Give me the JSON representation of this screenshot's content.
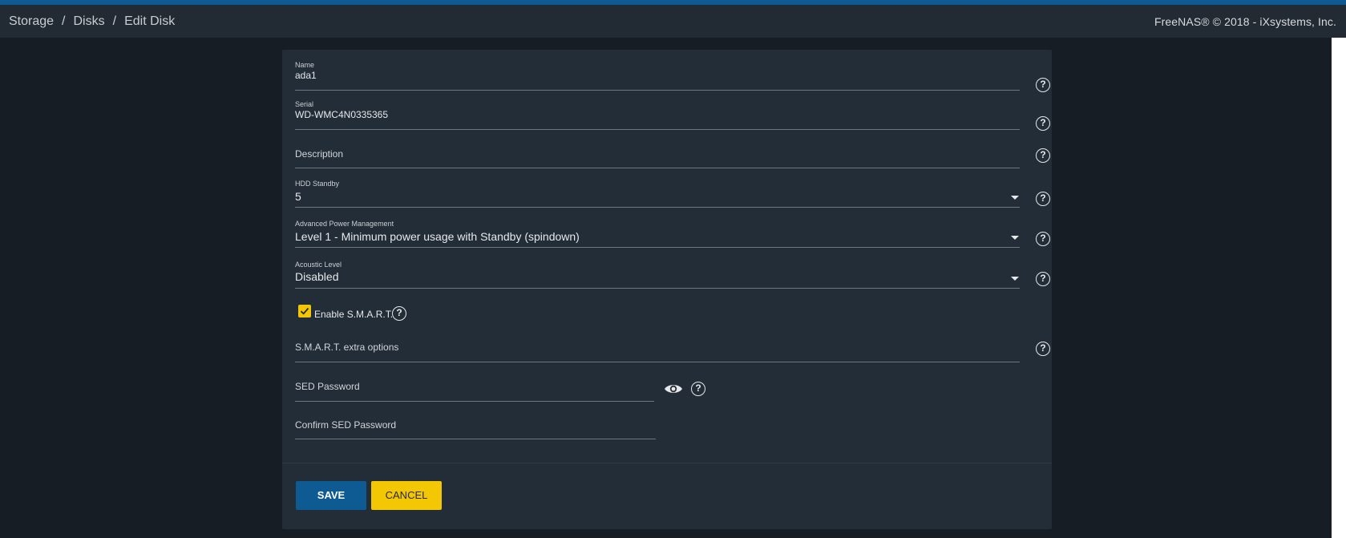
{
  "breadcrumb": {
    "items": [
      "Storage",
      "Disks",
      "Edit Disk"
    ],
    "separator": "/"
  },
  "header": {
    "copyright": "FreeNAS® © 2018 - iXsystems, Inc."
  },
  "form": {
    "name": {
      "label": "Name",
      "value": "ada1"
    },
    "serial": {
      "label": "Serial",
      "value": "WD-WMC4N0335365"
    },
    "description": {
      "placeholder": "Description"
    },
    "hdd_standby": {
      "label": "HDD Standby",
      "value": "5"
    },
    "apm": {
      "label": "Advanced Power Management",
      "value": "Level 1 - Minimum power usage with Standby (spindown)"
    },
    "acoustic": {
      "label": "Acoustic Level",
      "value": "Disabled"
    },
    "smart": {
      "label": "Enable S.M.A.R.T.",
      "checked": true
    },
    "smart_options": {
      "placeholder": "S.M.A.R.T. extra options"
    },
    "sed_password": {
      "placeholder": "SED Password"
    },
    "confirm_sed_password": {
      "placeholder": "Confirm SED Password"
    }
  },
  "buttons": {
    "save": "SAVE",
    "cancel": "CANCEL"
  },
  "icons": {
    "help": "help-circle-icon",
    "eye": "eye-icon",
    "caret": "caret-down-icon",
    "check": "check-icon"
  },
  "colors": {
    "accent": "#0e5a92",
    "warning": "#f3c704",
    "background": "#161d25",
    "card": "#232d37"
  }
}
